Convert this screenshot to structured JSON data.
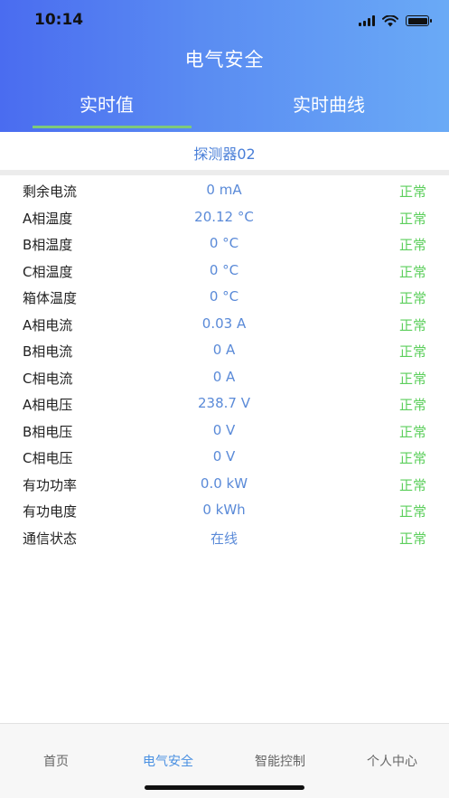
{
  "status_bar": {
    "time": "10:14"
  },
  "header": {
    "title": "电气安全",
    "tabs": [
      {
        "label": "实时值",
        "active": true
      },
      {
        "label": "实时曲线",
        "active": false
      }
    ],
    "accent_color": "#7ec97a"
  },
  "detector": {
    "name": "探测器02"
  },
  "rows": [
    {
      "label": "剩余电流",
      "value": "0 mA",
      "status": "正常"
    },
    {
      "label": "A相温度",
      "value": "20.12 °C",
      "status": "正常"
    },
    {
      "label": "B相温度",
      "value": "0 °C",
      "status": "正常"
    },
    {
      "label": "C相温度",
      "value": "0 °C",
      "status": "正常"
    },
    {
      "label": "箱体温度",
      "value": "0 °C",
      "status": "正常"
    },
    {
      "label": "A相电流",
      "value": "0.03 A",
      "status": "正常"
    },
    {
      "label": "B相电流",
      "value": "0 A",
      "status": "正常"
    },
    {
      "label": "C相电流",
      "value": "0 A",
      "status": "正常"
    },
    {
      "label": "A相电压",
      "value": "238.7 V",
      "status": "正常"
    },
    {
      "label": "B相电压",
      "value": "0 V",
      "status": "正常"
    },
    {
      "label": "C相电压",
      "value": "0 V",
      "status": "正常"
    },
    {
      "label": "有功功率",
      "value": "0.0 kW",
      "status": "正常"
    },
    {
      "label": "有功电度",
      "value": "0 kWh",
      "status": "正常"
    },
    {
      "label": "通信状态",
      "value": "在线",
      "status": "正常"
    }
  ],
  "bottom_nav": [
    {
      "label": "首页",
      "active": false
    },
    {
      "label": "电气安全",
      "active": true
    },
    {
      "label": "智能控制",
      "active": false
    },
    {
      "label": "个人中心",
      "active": false
    }
  ],
  "colors": {
    "value_color": "#5a8ad8",
    "status_ok_color": "#5ccf5c",
    "nav_active_color": "#4a90e2"
  }
}
